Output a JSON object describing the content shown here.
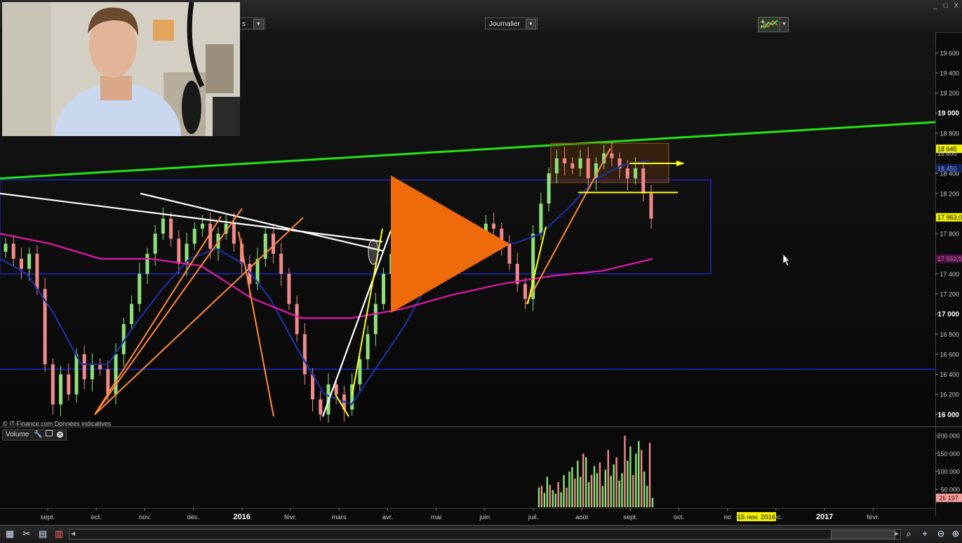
{
  "toolbar": {
    "period_select_value": "s",
    "timeframe_select_value": "Journalier"
  },
  "watermark": "© IT-Finance.com  Données indicatives",
  "volume_panel": {
    "label": "Volume"
  },
  "colors": {
    "background": "#0b0b0b",
    "up_candle": "#8ee07a",
    "down_candle": "#f08a8a",
    "sma_fast": "#1e2f9e",
    "sma_slow": "#e01aa8",
    "support_green": "#26e01a",
    "channel_blue": "#1b2ad0",
    "fan_orange": "#ff8a3a",
    "trend_white": "#ffffff",
    "trend_yellow": "#ffff1a",
    "play_button": "#ee6a0a",
    "price_tag_yellow": "#f2f200"
  },
  "chart_data": [
    {
      "type": "candlestick",
      "ylim": [
        15950,
        19700
      ],
      "y_ticks": [
        {
          "value": 19600,
          "label": "19 600",
          "major": false
        },
        {
          "value": 19400,
          "label": "19 400",
          "major": false
        },
        {
          "value": 19200,
          "label": "19 200",
          "major": false
        },
        {
          "value": 19000,
          "label": "19 000",
          "major": true
        },
        {
          "value": 18800,
          "label": "18 800",
          "major": false
        },
        {
          "value": 18400,
          "label": "18 400",
          "major": false
        },
        {
          "value": 18200,
          "label": "18 200",
          "major": false
        },
        {
          "value": 17800,
          "label": "17 800",
          "major": false
        },
        {
          "value": 17400,
          "label": "17 400",
          "major": false
        },
        {
          "value": 17200,
          "label": "17 200",
          "major": false
        },
        {
          "value": 17000,
          "label": "17 000",
          "major": true
        },
        {
          "value": 16800,
          "label": "16 800",
          "major": false
        },
        {
          "value": 16600,
          "label": "16 600",
          "major": false
        },
        {
          "value": 16400,
          "label": "16 400",
          "major": false
        },
        {
          "value": 16200,
          "label": "16 200",
          "major": false
        },
        {
          "value": 16000,
          "label": "16 000",
          "major": true
        }
      ],
      "x_ticks": [
        {
          "label": "sept.",
          "major": false
        },
        {
          "label": "oct.",
          "major": false
        },
        {
          "label": "nov.",
          "major": false
        },
        {
          "label": "déc.",
          "major": false
        },
        {
          "label": "2016",
          "major": true
        },
        {
          "label": "févr.",
          "major": false
        },
        {
          "label": "mars",
          "major": false
        },
        {
          "label": "avr.",
          "major": false
        },
        {
          "label": "mai",
          "major": false
        },
        {
          "label": "juin",
          "major": false
        },
        {
          "label": "juil.",
          "major": false
        },
        {
          "label": "août",
          "major": false
        },
        {
          "label": "sept.",
          "major": false
        },
        {
          "label": "oct.",
          "major": false
        },
        {
          "label": "no",
          "major": false
        },
        {
          "label": "déc.",
          "major": false
        },
        {
          "label": "2017",
          "major": true
        },
        {
          "label": "févr.",
          "major": false
        }
      ],
      "cursor_date_label": "15 nov. 2016",
      "price_tags": [
        {
          "value": 18645,
          "label": "18 645",
          "style": "yellow"
        },
        {
          "value": 18600,
          "label": "18 600",
          "style": "plain"
        },
        {
          "value": 18450,
          "label": "18 450",
          "style": "blue"
        },
        {
          "value": 17963,
          "label": "17 963,0",
          "style": "yellow"
        },
        {
          "value": 17552,
          "label": "17 552,0",
          "style": "magenta"
        }
      ],
      "series": [
        {
          "name": "close",
          "kind": "price",
          "values": [
            17700,
            17550,
            17450,
            17600,
            17250,
            16500,
            16100,
            16400,
            16200,
            16600,
            16350,
            16500,
            16450,
            16200,
            16600,
            16900,
            17100,
            17400,
            17600,
            17800,
            17950,
            17750,
            17500,
            17700,
            17850,
            17900,
            17650,
            17800,
            17900,
            17700,
            17500,
            17300,
            17550,
            17800,
            17600,
            17400,
            17100,
            16800,
            16400,
            16150,
            16000,
            16300,
            16200,
            16050,
            16300,
            16550,
            16800,
            17100,
            17400,
            17600,
            17800,
            17600,
            17700,
            17800,
            17550,
            17600,
            17750,
            17700,
            17600,
            17650,
            17750,
            17900,
            17850,
            17700,
            17500,
            17300,
            17150,
            17800,
            18100,
            18400,
            18550,
            18500,
            18450,
            18550,
            18350,
            18500,
            18600,
            18550,
            18450,
            18350,
            18450,
            18200,
            17950
          ]
        },
        {
          "name": "SMA fast",
          "kind": "sma",
          "values": [
            17550,
            17400,
            17000,
            16500,
            16500,
            16900,
            17250,
            17550,
            17650,
            17500,
            17150,
            16650,
            16200,
            16100,
            16500,
            16900,
            17400,
            17700,
            17760,
            17700,
            17800,
            18050,
            18340,
            18480,
            18530
          ]
        },
        {
          "name": "SMA slow",
          "kind": "sma",
          "values": [
            17800,
            17700,
            17550,
            17550,
            17480,
            17160,
            16960,
            16960,
            17050,
            17190,
            17300,
            17380,
            17430,
            17550
          ]
        },
        {
          "name": "Volume",
          "kind": "volume",
          "ylim": [
            0,
            210000
          ],
          "y_ticks": [
            {
              "value": 200000,
              "label": "200 000"
            },
            {
              "value": 150000,
              "label": "150 000"
            },
            {
              "value": 100000,
              "label": "100 000"
            },
            {
              "value": 50000,
              "label": "50 000"
            }
          ],
          "last_label": "26 197",
          "values": [
            55000,
            60000,
            40000,
            85000,
            62000,
            48000,
            38000,
            70000,
            42000,
            90000,
            55000,
            100000,
            112000,
            80000,
            130000,
            85000,
            150000,
            140000,
            70000,
            90000,
            115000,
            95000,
            125000,
            60000,
            105000,
            160000,
            88000,
            120000,
            140000,
            75000,
            95000,
            200000,
            130000,
            170000,
            90000,
            150000,
            185000,
            160000,
            100000,
            60000,
            180000,
            26197
          ]
        }
      ]
    }
  ]
}
